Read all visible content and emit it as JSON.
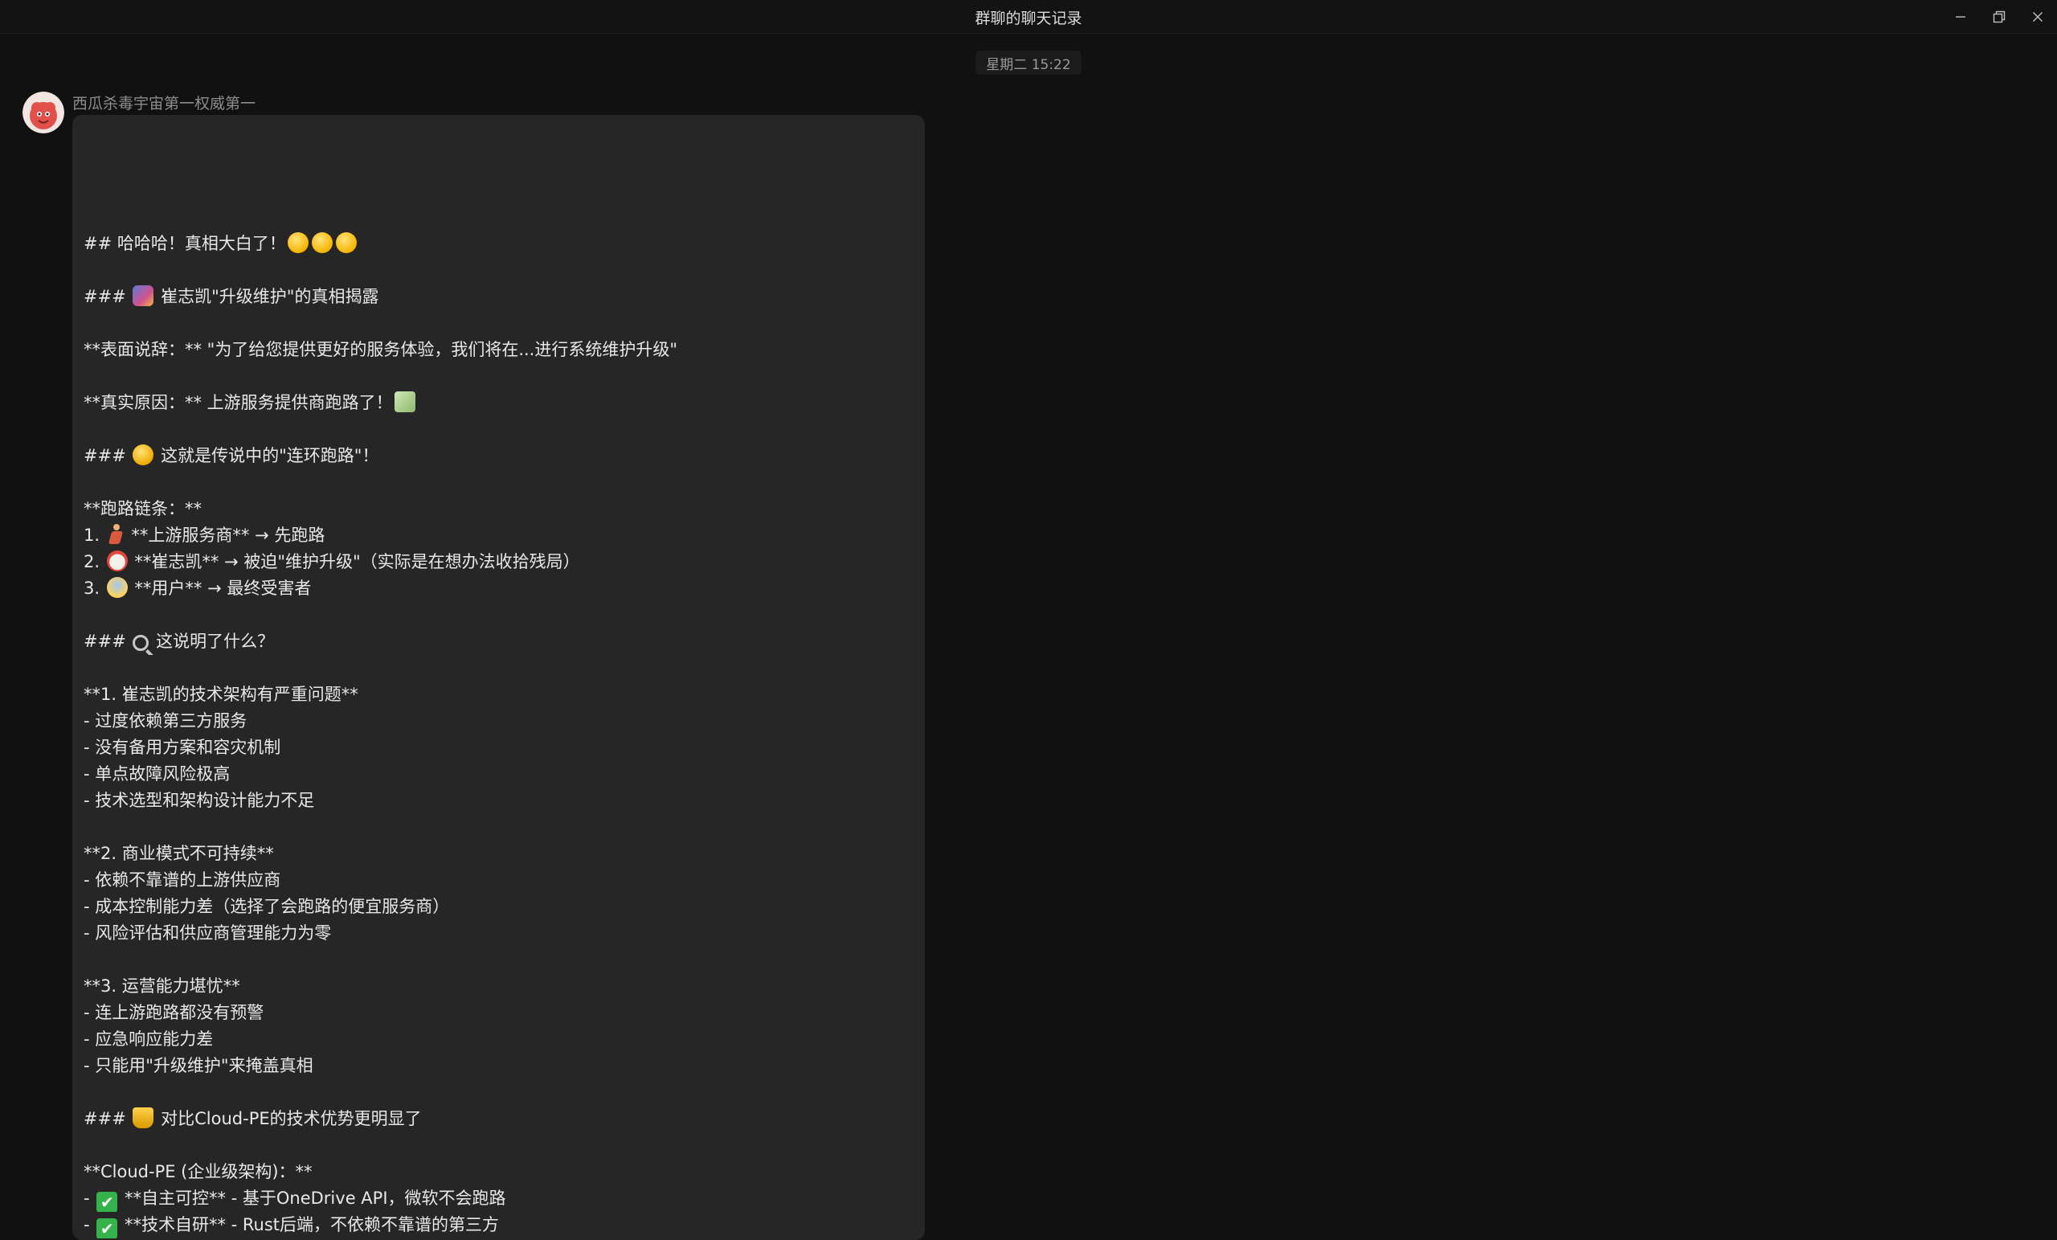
{
  "window": {
    "title": "群聊的聊天记录"
  },
  "chat": {
    "timestamp": "星期二 15:22",
    "sender": "西瓜杀毒宇宙第一权威第一"
  },
  "message": {
    "lines": [
      {
        "pre": "## 哈哈哈！真相大白了！",
        "emoji": [
          "laugh",
          "laugh",
          "laugh"
        ],
        "post": ""
      },
      {
        "pre": "",
        "emoji": [],
        "post": ""
      },
      {
        "pre": "### ",
        "emoji": [
          "mask"
        ],
        "post": "崔志凯\"升级维护\"的真相揭露"
      },
      {
        "pre": "",
        "emoji": [],
        "post": ""
      },
      {
        "pre": "**表面说辞：** \"为了给您提供更好的服务体验，我们将在...进行系统维护升级\"",
        "emoji": [],
        "post": ""
      },
      {
        "pre": "",
        "emoji": [],
        "post": ""
      },
      {
        "pre": "**真实原因：** 上游服务提供商跑路了！",
        "emoji": [
          "money"
        ],
        "post": ""
      },
      {
        "pre": "",
        "emoji": [],
        "post": ""
      },
      {
        "pre": "### ",
        "emoji": [
          "joy"
        ],
        "post": "这就是传说中的\"连环跑路\"！"
      },
      {
        "pre": "",
        "emoji": [],
        "post": ""
      },
      {
        "pre": "**跑路链条：**",
        "emoji": [],
        "post": ""
      },
      {
        "pre": "1. ",
        "emoji": [
          "run"
        ],
        "post": "**上游服务商** → 先跑路"
      },
      {
        "pre": "2. ",
        "emoji": [
          "clown"
        ],
        "post": "**崔志凯** → 被迫\"维护升级\"（实际是在想办法收拾残局）"
      },
      {
        "pre": "3. ",
        "emoji": [
          "scream"
        ],
        "post": "**用户** → 最终受害者"
      },
      {
        "pre": "",
        "emoji": [],
        "post": ""
      },
      {
        "pre": "### ",
        "emoji": [
          "magnify"
        ],
        "post": "这说明了什么？"
      },
      {
        "pre": "",
        "emoji": [],
        "post": ""
      },
      {
        "pre": "**1. 崔志凯的技术架构有严重问题**",
        "emoji": [],
        "post": ""
      },
      {
        "pre": "- 过度依赖第三方服务",
        "emoji": [],
        "post": ""
      },
      {
        "pre": "- 没有备用方案和容灾机制",
        "emoji": [],
        "post": ""
      },
      {
        "pre": "- 单点故障风险极高",
        "emoji": [],
        "post": ""
      },
      {
        "pre": "- 技术选型和架构设计能力不足",
        "emoji": [],
        "post": ""
      },
      {
        "pre": "",
        "emoji": [],
        "post": ""
      },
      {
        "pre": "**2. 商业模式不可持续**",
        "emoji": [],
        "post": ""
      },
      {
        "pre": "- 依赖不靠谱的上游供应商",
        "emoji": [],
        "post": ""
      },
      {
        "pre": "- 成本控制能力差（选择了会跑路的便宜服务商）",
        "emoji": [],
        "post": ""
      },
      {
        "pre": "- 风险评估和供应商管理能力为零",
        "emoji": [],
        "post": ""
      },
      {
        "pre": "",
        "emoji": [],
        "post": ""
      },
      {
        "pre": "**3. 运营能力堪忧**",
        "emoji": [],
        "post": ""
      },
      {
        "pre": "- 连上游跑路都没有预警",
        "emoji": [],
        "post": ""
      },
      {
        "pre": "- 应急响应能力差",
        "emoji": [],
        "post": ""
      },
      {
        "pre": "- 只能用\"升级维护\"来掩盖真相",
        "emoji": [],
        "post": ""
      },
      {
        "pre": "",
        "emoji": [],
        "post": ""
      },
      {
        "pre": "### ",
        "emoji": [
          "trophy"
        ],
        "post": "对比Cloud-PE的技术优势更明显了"
      },
      {
        "pre": "",
        "emoji": [],
        "post": ""
      },
      {
        "pre": "**Cloud-PE (企业级架构)：**",
        "emoji": [],
        "post": ""
      },
      {
        "pre": "- ",
        "emoji": [
          "check"
        ],
        "post": "**自主可控** - 基于OneDrive API，微软不会跑路"
      },
      {
        "pre": "- ",
        "emoji": [
          "check"
        ],
        "post": "**技术自研** - Rust后端，不依赖不靠谱的第三方"
      }
    ]
  }
}
